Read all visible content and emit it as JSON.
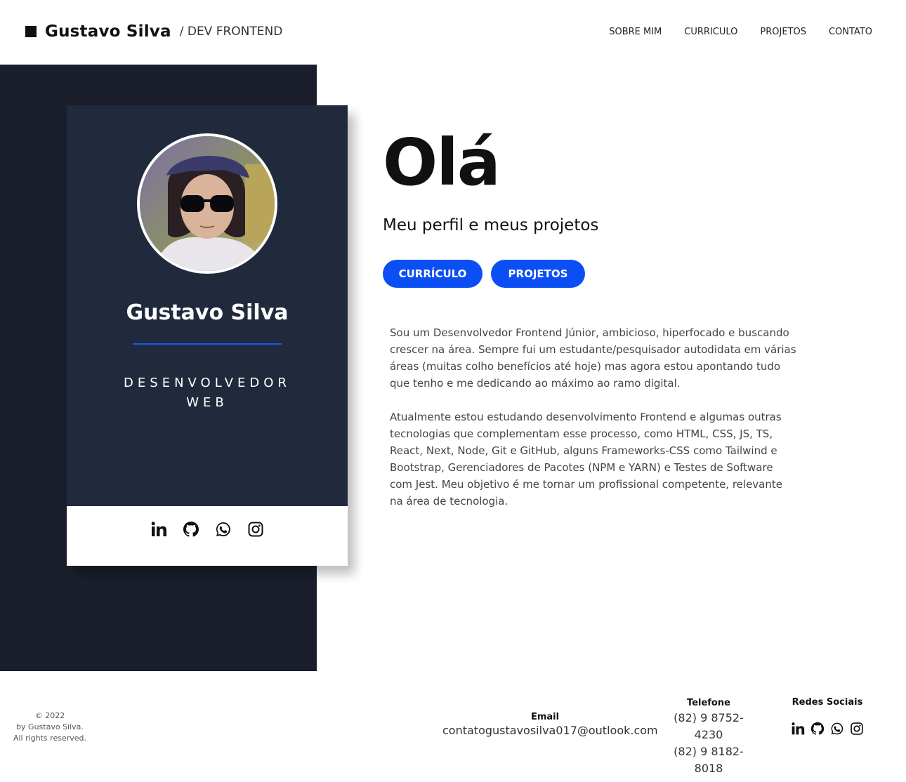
{
  "header": {
    "name": "Gustavo Silva",
    "subtitle": "/ DEV FRONTEND",
    "nav": [
      "SOBRE MIM",
      "CURRICULO",
      "PROJETOS",
      "CONTATO"
    ]
  },
  "card": {
    "name": "Gustavo Silva",
    "role_line1": "DESENVOLVEDOR",
    "role_line2": "WEB",
    "social_icons": [
      "linkedin-icon",
      "github-icon",
      "whatsapp-icon",
      "instagram-icon"
    ]
  },
  "hero": {
    "title": "Olá",
    "subtitle": "Meu perfil e meus projetos",
    "btn_cv": "CURRÍCULO",
    "btn_projects": "PROJETOS"
  },
  "about": {
    "p1": "Sou um Desenvolvedor Frontend Júnior, ambicioso, hiperfocado e buscando crescer na área. Sempre fui um estudante/pesquisador autodidata em várias áreas (muitas colho benefícios até hoje) mas agora estou apontando tudo que tenho e me dedicando ao máximo ao ramo digital.",
    "p2": "Atualmente estou estudando desenvolvimento Frontend e algumas outras tecnologias que complementam esse processo, como HTML, CSS, JS, TS, React, Next, Node, Git e GitHub, alguns Frameworks-CSS como Tailwind e Bootstrap, Gerenciadores de Pacotes (NPM e YARN) e Testes de Software com Jest. Meu objetivo é me tornar um profissional competente, relevante na área de tecnologia."
  },
  "footer": {
    "copy_line1": "© 2022",
    "copy_line2": "by Gustavo Silva.",
    "copy_line3": "All rights reserved.",
    "email_label": "Email",
    "email": "contatogustavosilva017@outlook.com",
    "phone_label": "Telefone",
    "phone1": "(82) 9 8752-4230",
    "phone2": "(82) 9 8182-8018",
    "social_label": "Redes Sociais"
  },
  "colors": {
    "accent": "#0b4ff4",
    "dark_band": "#1a1f2b",
    "card": "#212a3d"
  }
}
